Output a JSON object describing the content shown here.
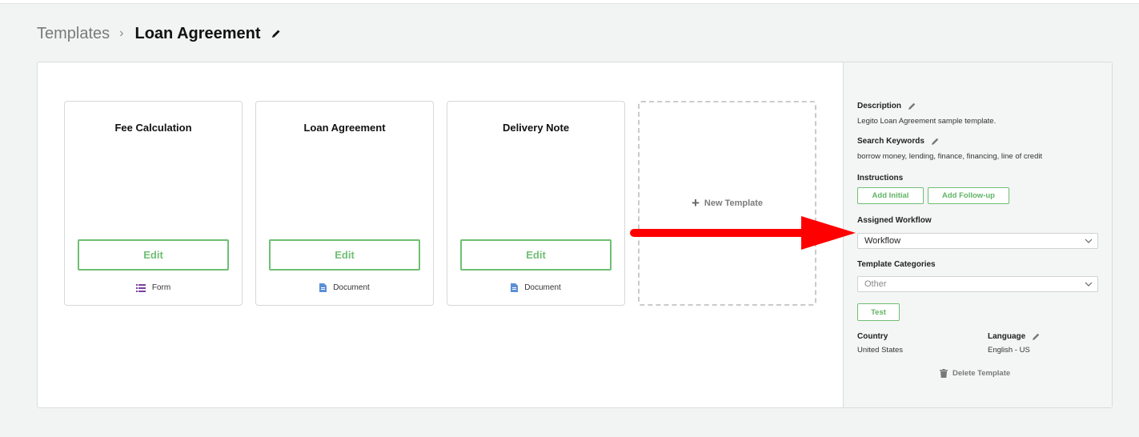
{
  "breadcrumb": {
    "parent": "Templates",
    "separator": "›",
    "current": "Loan Agreement"
  },
  "cards": [
    {
      "title": "Fee Calculation",
      "edit_label": "Edit",
      "type_label": "Form",
      "type_icon": "list-icon"
    },
    {
      "title": "Loan Agreement",
      "edit_label": "Edit",
      "type_label": "Document",
      "type_icon": "document-icon"
    },
    {
      "title": "Delivery Note",
      "edit_label": "Edit",
      "type_label": "Document",
      "type_icon": "document-icon"
    }
  ],
  "new_template": {
    "icon": "+",
    "label": "New Template"
  },
  "sidebar": {
    "description_label": "Description",
    "description_value": "Legito Loan Agreement sample template.",
    "keywords_label": "Search Keywords",
    "keywords_value": "borrow money, lending, finance, financing, line of credit",
    "instructions_label": "Instructions",
    "add_initial": "Add Initial",
    "add_followup": "Add Follow-up",
    "workflow_label": "Assigned Workflow",
    "workflow_value": "Workflow",
    "categories_label": "Template Categories",
    "categories_placeholder": "Other",
    "test_label": "Test",
    "country_label": "Country",
    "country_value": "United States",
    "language_label": "Language",
    "language_value": "English - US",
    "delete_label": "Delete Template"
  },
  "colors": {
    "accent_green": "#6fbf73",
    "arrow_red": "#ff0000",
    "form_icon_purple": "#7b3fa0",
    "document_icon_blue": "#5b8fd6"
  }
}
